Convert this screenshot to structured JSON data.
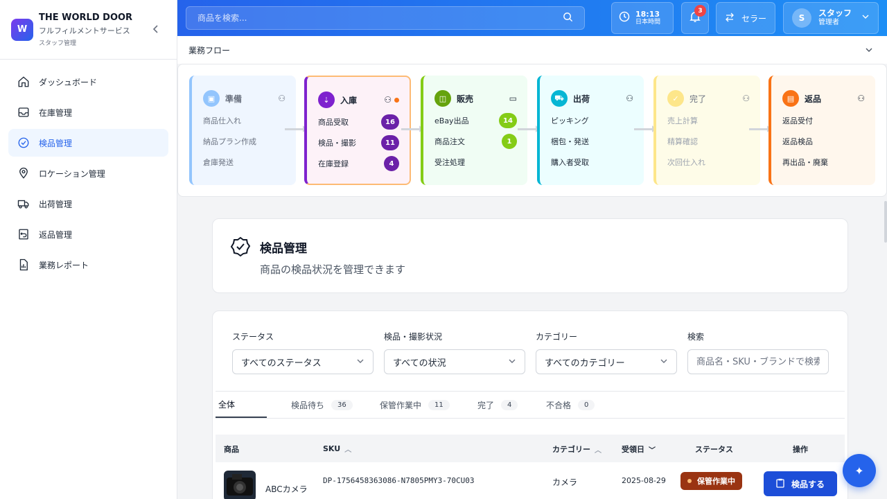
{
  "brand": {
    "logo_letter": "W",
    "name": "THE WORLD DOOR",
    "subtitle": "フルフィルメントサービス",
    "role_label": "スタッフ管理"
  },
  "sidebar": {
    "items": [
      {
        "label": "ダッシュボード",
        "icon": "home-icon",
        "active": false
      },
      {
        "label": "在庫管理",
        "icon": "inbox-icon",
        "active": false
      },
      {
        "label": "検品管理",
        "icon": "check-circle-icon",
        "active": true
      },
      {
        "label": "ロケーション管理",
        "icon": "map-pin-icon",
        "active": false
      },
      {
        "label": "出荷管理",
        "icon": "truck-icon",
        "active": false
      },
      {
        "label": "返品管理",
        "icon": "return-icon",
        "active": false
      },
      {
        "label": "業務レポート",
        "icon": "report-icon",
        "active": false
      }
    ]
  },
  "header": {
    "search_placeholder": "商品を検索...",
    "clock_time": "18:13",
    "clock_tz": "日本時間",
    "notification_count": "3",
    "switch_label": "セラー",
    "user_initial": "S",
    "user_name": "スタッフ",
    "user_role": "管理者"
  },
  "workflow": {
    "title": "業務フロー",
    "cards": [
      {
        "title": "準備",
        "rows": [
          {
            "label": "商品仕入れ"
          },
          {
            "label": "納品プラン作成"
          },
          {
            "label": "倉庫発送"
          }
        ]
      },
      {
        "title": "入庫",
        "rows": [
          {
            "label": "商品受取",
            "count": "16"
          },
          {
            "label": "検品・撮影",
            "count": "11"
          },
          {
            "label": "在庫登録",
            "count": "4"
          }
        ]
      },
      {
        "title": "販売",
        "rows": [
          {
            "label": "eBay出品",
            "count": "14"
          },
          {
            "label": "商品注文",
            "count": "1"
          },
          {
            "label": "受注処理"
          }
        ]
      },
      {
        "title": "出荷",
        "rows": [
          {
            "label": "ピッキング"
          },
          {
            "label": "梱包・発送"
          },
          {
            "label": "購入者受取"
          }
        ]
      },
      {
        "title": "完了",
        "rows": [
          {
            "label": "売上計算"
          },
          {
            "label": "精算確認"
          },
          {
            "label": "次回仕入れ"
          }
        ]
      },
      {
        "title": "返品",
        "rows": [
          {
            "label": "返品受付"
          },
          {
            "label": "返品検品"
          },
          {
            "label": "再出品・廃棄"
          }
        ]
      }
    ]
  },
  "page": {
    "title": "検品管理",
    "subtitle": "商品の検品状況を管理できます"
  },
  "filters": {
    "status_label": "ステータス",
    "status_value": "すべてのステータス",
    "inspection_label": "検品・撮影状況",
    "inspection_value": "すべての状況",
    "category_label": "カテゴリー",
    "category_value": "すべてのカテゴリー",
    "search_label": "検索",
    "search_placeholder": "商品名・SKU・ブランドで検索"
  },
  "tabs": [
    {
      "label": "全体",
      "count": ""
    },
    {
      "label": "検品待ち",
      "count": "36"
    },
    {
      "label": "保管作業中",
      "count": "11"
    },
    {
      "label": "完了",
      "count": "4"
    },
    {
      "label": "不合格",
      "count": "0"
    }
  ],
  "table": {
    "headers": {
      "product": "商品",
      "sku": "SKU",
      "category": "カテゴリー",
      "date": "受領日",
      "status": "ステータス",
      "action": "操作"
    },
    "rows": [
      {
        "product": "ABCカメラ",
        "sku": "DP-1756458363086-N7805PMY3-70CU03",
        "category": "カメラ",
        "date": "2025-08-29",
        "status": "保管作業中",
        "action": "検品する"
      }
    ]
  },
  "colors": {
    "primary": "#2563eb",
    "accent_purple": "#7c3aed",
    "accent_green": "#84cc16",
    "accent_orange": "#f97316"
  }
}
